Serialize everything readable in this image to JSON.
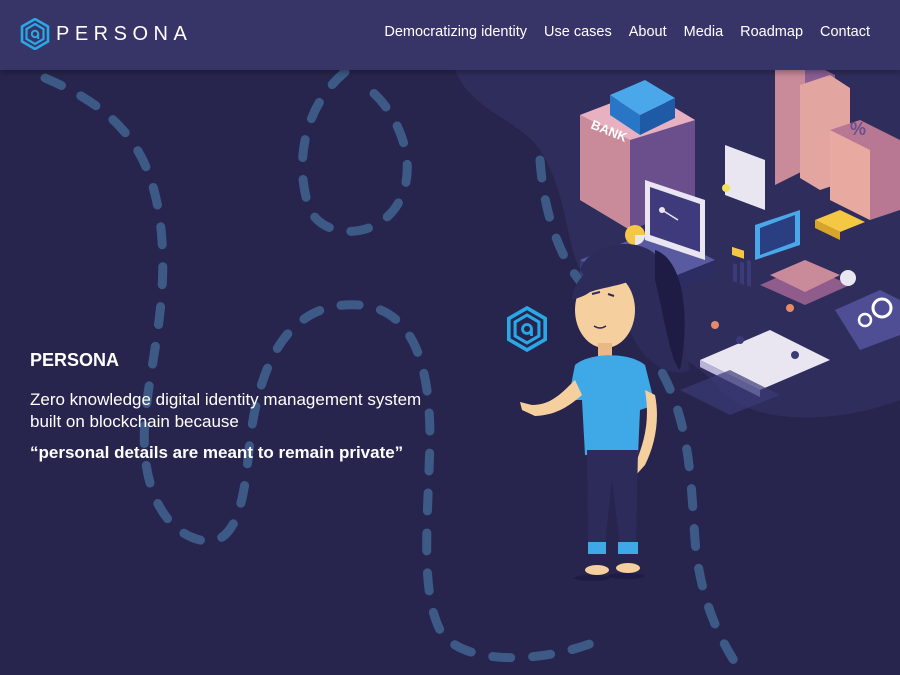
{
  "brand": {
    "name": "PERSONA",
    "logo_icon": "persona-hexagon-logo-icon",
    "accent_color": "#2aa8e6"
  },
  "nav": {
    "items": [
      {
        "label": "Democratizing identity"
      },
      {
        "label": "Use cases"
      },
      {
        "label": "About"
      },
      {
        "label": "Media"
      },
      {
        "label": "Roadmap"
      },
      {
        "label": "Contact"
      }
    ]
  },
  "hero": {
    "title": "PERSONA",
    "description": "Zero knowledge digital identity management system built on blockchain because",
    "quote": "“personal details are meant to remain private”"
  },
  "illustration": {
    "bank_label": "BANK"
  },
  "colors": {
    "background": "#27254d",
    "header": "#373567",
    "dash": "#3d5a86"
  }
}
